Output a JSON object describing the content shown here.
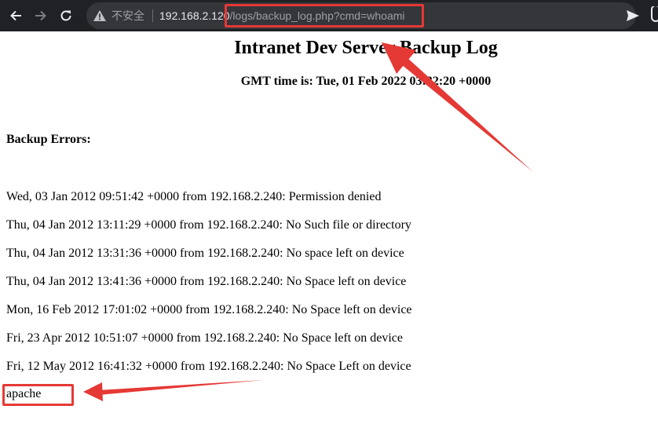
{
  "browser": {
    "security_label": "不安全",
    "url_host": "192.168.2.120",
    "url_path": "/logs/backup_log.php?cmd=whoami",
    "icons": [
      "back-arrow-icon",
      "forward-arrow-icon",
      "reload-icon",
      "warning-icon",
      "send-icon",
      "extension-icon"
    ]
  },
  "page": {
    "title": "Intranet Dev Server Backup Log",
    "gmt_time": "GMT time is: Tue, 01 Feb 2022 03:32:20 +0000",
    "errors_heading": "Backup Errors:",
    "log_entries": [
      "Wed, 03 Jan 2012 09:51:42 +0000 from 192.168.2.240: Permission denied",
      "Thu, 04 Jan 2012 13:11:29 +0000 from 192.168.2.240: No Such file or directory",
      "Thu, 04 Jan 2012 13:31:36 +0000 from 192.168.2.240: No space left on device",
      "Thu, 04 Jan 2012 13:41:36 +0000 from 192.168.2.240: No Space left on device",
      "Mon, 16 Feb 2012 17:01:02 +0000 from 192.168.2.240: No Space left on device",
      "Fri, 23 Apr 2012 10:51:07 +0000 from 192.168.2.240: No Space left on device",
      "Fri, 12 May 2012 16:41:32 +0000 from 192.168.2.240: No Space Left on device"
    ],
    "command_output": "apache"
  },
  "annotations": {
    "color": "#e53935"
  }
}
